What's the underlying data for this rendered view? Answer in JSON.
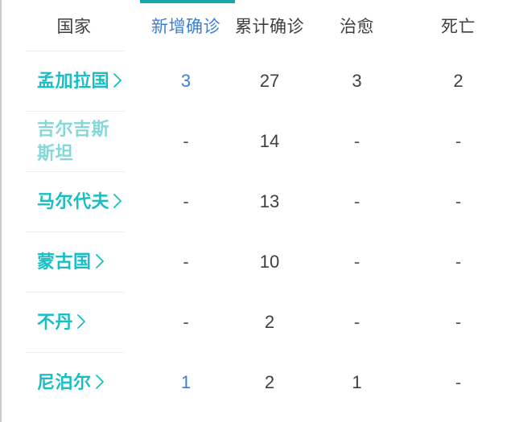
{
  "table": {
    "columns": [
      {
        "key": "country",
        "label": "国家",
        "accent": "neutral"
      },
      {
        "key": "new",
        "label": "新增确诊",
        "accent": "blue"
      },
      {
        "key": "total",
        "label": "累计确诊",
        "accent": "neutral"
      },
      {
        "key": "cured",
        "label": "治愈",
        "accent": "neutral"
      },
      {
        "key": "death",
        "label": "死亡",
        "accent": "neutral"
      }
    ],
    "active_column": "新增确诊",
    "rows": [
      {
        "country": "孟加拉国",
        "has_chevron": true,
        "faded": false,
        "new": "3",
        "total": "27",
        "cured": "3",
        "death": "2"
      },
      {
        "country": "吉尔吉斯斯坦",
        "has_chevron": false,
        "faded": true,
        "new": "-",
        "total": "14",
        "cured": "-",
        "death": "-"
      },
      {
        "country": "马尔代夫",
        "has_chevron": true,
        "faded": false,
        "new": "-",
        "total": "13",
        "cured": "-",
        "death": "-"
      },
      {
        "country": "蒙古国",
        "has_chevron": true,
        "faded": false,
        "new": "-",
        "total": "10",
        "cured": "-",
        "death": "-"
      },
      {
        "country": "不丹",
        "has_chevron": true,
        "faded": false,
        "new": "-",
        "total": "2",
        "cured": "-",
        "death": "-"
      },
      {
        "country": "尼泊尔",
        "has_chevron": true,
        "faded": false,
        "new": "1",
        "total": "2",
        "cured": "1",
        "death": "-"
      }
    ]
  },
  "colors": {
    "accent_teal": "#17bfc4",
    "accent_teal_faded": "#84d8da",
    "accent_blue": "#3b7fd4",
    "indicator_teal": "#16a7a9",
    "text_primary": "#3f3f3f",
    "row_divider": "#ededf0"
  },
  "icons": {
    "chevron_right": "chevron-right-icon"
  }
}
